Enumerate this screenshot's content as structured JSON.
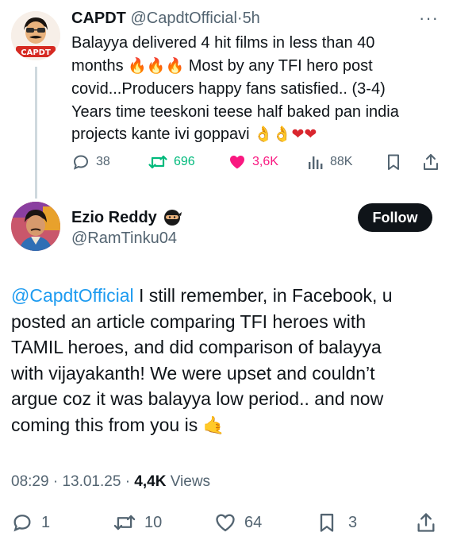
{
  "parent_tweet": {
    "avatar_text": "CAPDT",
    "name": "CAPDT",
    "handle": "@CapdtOfficial",
    "separator": "·",
    "time": "5h",
    "text_line1": "Balayya delivered 4 hit films in less than 40",
    "text_line2_a": "months",
    "text_line2_b": "Most by any TFI hero post",
    "text_line3": "covid...Producers happy fans satisfied.. (3-4)",
    "text_line4": "Years time teeskoni  teese half baked pan india",
    "text_line5": "projects kante ivi goppavi",
    "fire_emoji": "🔥",
    "ok_emoji": "👌",
    "heart_emoji": "❤",
    "actions": {
      "replies": "38",
      "reposts": "696",
      "likes": "3,6K",
      "views": "88K"
    }
  },
  "reply_tweet": {
    "name": "Ezio Reddy",
    "handle": "@RamTinku04",
    "follow_label": "Follow",
    "mention": "@CapdtOfficial",
    "text_line1": "I still remember, in Facebook, u",
    "text_line2": "posted an article comparing TFI heroes with",
    "text_line3": "TAMIL heroes, and did comparison of balayya",
    "text_line4": "with vijayakanth! We were upset and couldn’t",
    "text_line5": "argue coz it was balayya low period.. and now",
    "text_line6": "coming this from you is",
    "hand_emoji": "🤙",
    "time": "08:29",
    "dot": "·",
    "date": "13.01.25",
    "views_count": "4,4K",
    "views_label": "Views",
    "actions": {
      "replies": "1",
      "reposts": "10",
      "likes": "64",
      "bookmarks": "3"
    }
  },
  "colors": {
    "text": "#0f1419",
    "muted": "#536471",
    "link": "#1d9bf0",
    "repost_active": "#00ba7c",
    "like_active": "#f91880",
    "thread_line": "#cfd9de"
  }
}
